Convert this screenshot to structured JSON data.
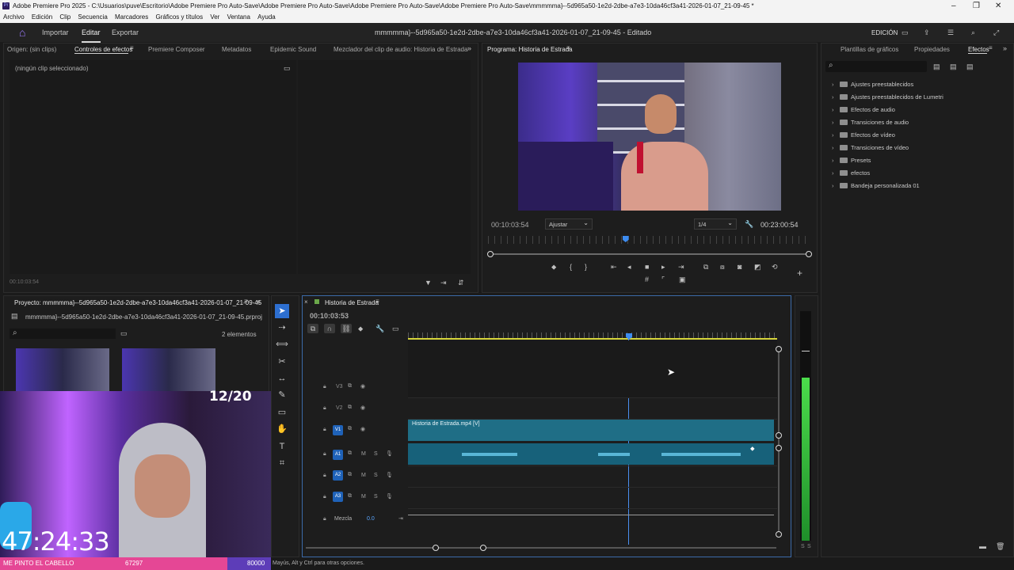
{
  "window": {
    "title": "Adobe Premiere Pro 2025 - C:\\Usuarios\\puve\\Escritorio\\Adobe Premiere Pro Auto-Save\\Adobe Premiere Pro Auto-Save\\Adobe Premiere Pro Auto-Save\\Adobe Premiere Pro Auto-Save\\mmmmma}--5d965a50-1e2d-2dbe-a7e3-10da46cf3a41-2026-01-07_21-09-45 *"
  },
  "menu": [
    "Archivo",
    "Edición",
    "Clip",
    "Secuencia",
    "Marcadores",
    "Gráficos y títulos",
    "Ver",
    "Ventana",
    "Ayuda"
  ],
  "header": {
    "tabs": [
      "Importar",
      "Editar",
      "Exportar"
    ],
    "active_tab": "Editar",
    "doc_title": "mmmmma}--5d965a50-1e2d-2dbe-a7e3-10da46cf3a41-2026-01-07_21-09-45 - Editado",
    "workspace": "EDICIÓN"
  },
  "source_panel": {
    "tabs": [
      "Origen: (sin clips)",
      "Controles de efectos",
      "Premiere Composer",
      "Metadatos",
      "Epidemic Sound",
      "Mezclador del clip de audio: Historia de Estrada"
    ],
    "active": "Controles de efectos",
    "no_clip": "(ningún clip seleccionado)",
    "timecode": "00:10:03:54"
  },
  "program_monitor": {
    "title": "Programa: Historia de Estrada",
    "timecode": "00:10:03:54",
    "fit": "Ajustar",
    "resolution": "1/4",
    "duration": "00:23:00:54",
    "playhead_fraction": 0.43
  },
  "effects_panel": {
    "tabs": [
      "Plantillas de gráficos",
      "Propiedades",
      "Efectos"
    ],
    "active": "Efectos",
    "items": [
      "Ajustes preestablecidos",
      "Ajustes preestablecidos de Lumetri",
      "Efectos de audio",
      "Transiciones de audio",
      "Efectos de vídeo",
      "Transiciones de vídeo",
      "Presets",
      "efectos",
      "Bandeja personalizada 01"
    ]
  },
  "project_panel": {
    "title": "Proyecto: mmmmma}--5d965a50-1e2d-2dbe-a7e3-10da46cf3a41-2026-01-07_21-09-45",
    "file": "mmmmma}--5d965a50-1e2d-2dbe-a7e3-10da46cf3a41-2026-01-07_21-09-45.prproj",
    "count": "2 elementos"
  },
  "timeline": {
    "title": "Historia de Estrada",
    "timecode": "00:10:03:53",
    "video_tracks": [
      "V3",
      "V2",
      "V1"
    ],
    "audio_tracks": [
      "A1",
      "A2",
      "A3"
    ],
    "clip_name": "Historia de Estrada.mp4 [V]",
    "mix_label": "Mezcla",
    "mix_value": "0.0",
    "m": "M",
    "s": "S"
  },
  "overlay": {
    "counter": "12/20",
    "clock": "47:24:33",
    "banner_text": "ME PINTO EL CABELLO",
    "banner_count": "67297",
    "banner_goal": "80000"
  },
  "status": {
    "hint": "Mayús, Alt y Ctrl para otras opciones."
  },
  "meter": {
    "labels": [
      "S",
      "S"
    ]
  },
  "colors": {
    "accent": "#2d8ceb",
    "clip": "#1f6e86",
    "banner": "#e54795"
  }
}
